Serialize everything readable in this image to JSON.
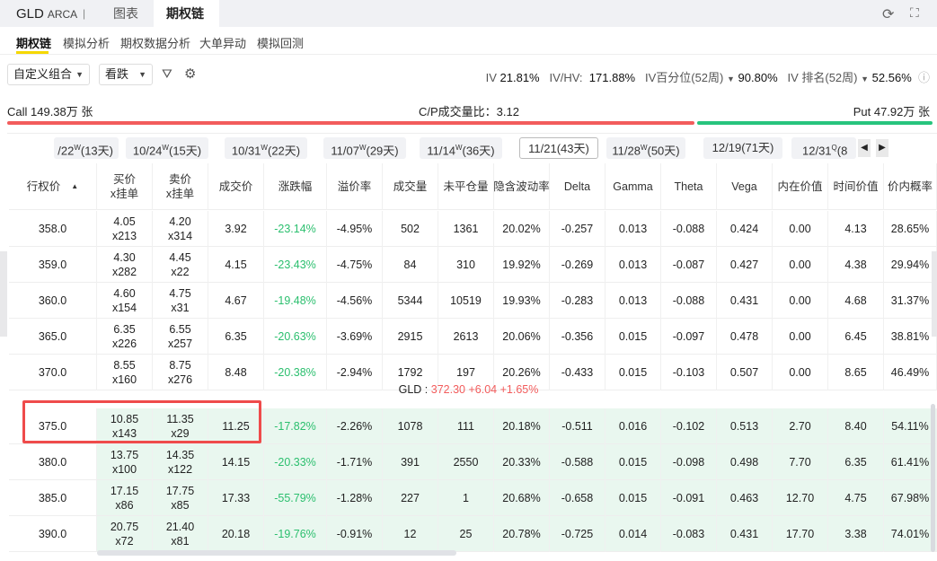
{
  "header": {
    "symbol": "GLD",
    "exchange": "ARCA",
    "separator": "|",
    "tabs": [
      "图表",
      "期权链"
    ]
  },
  "subnav": [
    "期权链",
    "模拟分析",
    "期权数据分析",
    "大单异动",
    "模拟回测"
  ],
  "toolbar": {
    "combo": "自定义组合",
    "direction": "看跌"
  },
  "iv": {
    "iv_label": "IV",
    "iv": "21.81%",
    "ivhv_label": "IV/HV:",
    "ivhv": "171.88%",
    "pct_label": "IV百分位(52周)",
    "pct": "90.80%",
    "rank_label": "IV 排名(52周)",
    "rank": "52.56%"
  },
  "volume": {
    "call": "Call 149.38万 张",
    "cp": "C/P成交量比：3.12",
    "put": "Put 47.92万 张",
    "call_fraction": 0.757
  },
  "expirations": [
    {
      "date": "/22",
      "w": "W",
      "days": "(13天)"
    },
    {
      "date": "10/24",
      "w": "W",
      "days": "(15天)"
    },
    {
      "date": "10/31",
      "w": "W",
      "days": "(22天)"
    },
    {
      "date": "11/07",
      "w": "W",
      "days": "(29天)"
    },
    {
      "date": "11/14",
      "w": "W",
      "days": "(36天)"
    },
    {
      "date": "11/21",
      "w": "",
      "days": "(43天)"
    },
    {
      "date": "11/28",
      "w": "W",
      "days": "(50天)"
    },
    {
      "date": "12/19",
      "w": "",
      "days": "(71天)"
    },
    {
      "date": "12/31",
      "w": "Q",
      "days": "(8"
    }
  ],
  "columns": [
    "行权价",
    "买价\nx挂单",
    "卖价\nx挂单",
    "成交价",
    "涨跌幅",
    "溢价率",
    "成交量",
    "未平仓量",
    "隐含波动率",
    "Delta",
    "Gamma",
    "Theta",
    "Vega",
    "内在价值",
    "时间价值",
    "价内概率"
  ],
  "rows_otm": [
    [
      "358.0",
      "4.05\nx213",
      "4.20\nx314",
      "3.92",
      "-23.14%",
      "-4.95%",
      "502",
      "1361",
      "20.02%",
      "-0.257",
      "0.013",
      "-0.088",
      "0.424",
      "0.00",
      "4.13",
      "28.65%"
    ],
    [
      "359.0",
      "4.30\nx282",
      "4.45\nx22",
      "4.15",
      "-23.43%",
      "-4.75%",
      "84",
      "310",
      "19.92%",
      "-0.269",
      "0.013",
      "-0.087",
      "0.427",
      "0.00",
      "4.38",
      "29.94%"
    ],
    [
      "360.0",
      "4.60\nx154",
      "4.75\nx31",
      "4.67",
      "-19.48%",
      "-4.56%",
      "5344",
      "10519",
      "19.93%",
      "-0.283",
      "0.013",
      "-0.088",
      "0.431",
      "0.00",
      "4.68",
      "31.37%"
    ],
    [
      "365.0",
      "6.35\nx226",
      "6.55\nx257",
      "6.35",
      "-20.63%",
      "-3.69%",
      "2915",
      "2613",
      "20.06%",
      "-0.356",
      "0.015",
      "-0.097",
      "0.478",
      "0.00",
      "6.45",
      "38.81%"
    ],
    [
      "370.0",
      "8.55\nx160",
      "8.75\nx276",
      "8.48",
      "-20.38%",
      "-2.94%",
      "1792",
      "197",
      "20.26%",
      "-0.433",
      "0.015",
      "-0.103",
      "0.507",
      "0.00",
      "8.65",
      "46.49%"
    ]
  ],
  "underlying": {
    "label": "GLD :",
    "price": "372.30",
    "change": "+6.04",
    "pct": "+1.65%"
  },
  "rows_itm": [
    [
      "375.0",
      "10.85\nx143",
      "11.35\nx29",
      "11.25",
      "-17.82%",
      "-2.26%",
      "1078",
      "111",
      "20.18%",
      "-0.511",
      "0.016",
      "-0.102",
      "0.513",
      "2.70",
      "8.40",
      "54.11%"
    ],
    [
      "380.0",
      "13.75\nx100",
      "14.35\nx122",
      "14.15",
      "-20.33%",
      "-1.71%",
      "391",
      "2550",
      "20.33%",
      "-0.588",
      "0.015",
      "-0.098",
      "0.498",
      "7.70",
      "6.35",
      "61.41%"
    ],
    [
      "385.0",
      "17.15\nx86",
      "17.75\nx85",
      "17.33",
      "-55.79%",
      "-1.28%",
      "227",
      "1",
      "20.68%",
      "-0.658",
      "0.015",
      "-0.091",
      "0.463",
      "12.70",
      "4.75",
      "67.98%"
    ],
    [
      "390.0",
      "20.75\nx72",
      "21.40\nx81",
      "20.18",
      "-19.76%",
      "-0.91%",
      "12",
      "25",
      "20.78%",
      "-0.725",
      "0.014",
      "-0.083",
      "0.431",
      "17.70",
      "3.38",
      "74.01%"
    ]
  ],
  "colors": {
    "red": "#f25c5c",
    "green": "#27c47d",
    "itm_bg": "#e9f7ef",
    "accent": "#f5d800"
  }
}
